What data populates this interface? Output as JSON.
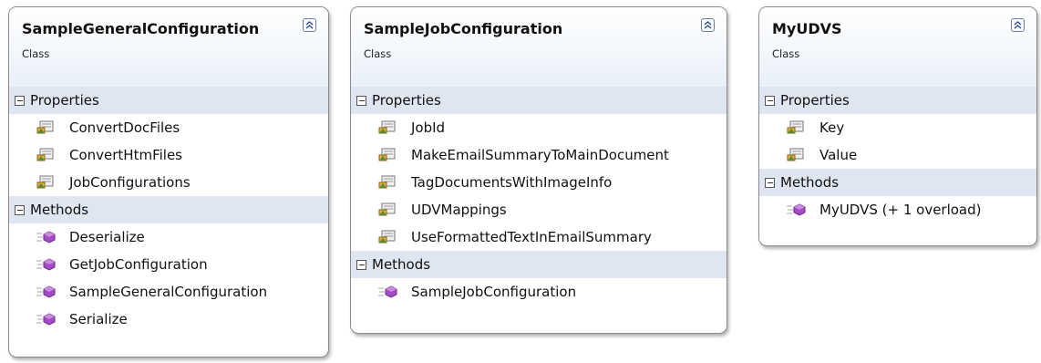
{
  "classes": [
    {
      "name": "SampleGeneralConfiguration",
      "stereotype": "Class",
      "properties_label": "Properties",
      "properties": [
        "ConvertDocFiles",
        "ConvertHtmFiles",
        "JobConfigurations"
      ],
      "methods_label": "Methods",
      "methods": [
        "Deserialize",
        "GetJobConfiguration",
        "SampleGeneralConfiguration",
        "Serialize"
      ]
    },
    {
      "name": "SampleJobConfiguration",
      "stereotype": "Class",
      "properties_label": "Properties",
      "properties": [
        "JobId",
        "MakeEmailSummaryToMainDocument",
        "TagDocumentsWithImageInfo",
        "UDVMappings",
        "UseFormattedTextInEmailSummary"
      ],
      "methods_label": "Methods",
      "methods": [
        "SampleJobConfiguration"
      ]
    },
    {
      "name": "MyUDVS",
      "stereotype": "Class",
      "properties_label": "Properties",
      "properties": [
        "Key",
        "Value"
      ],
      "methods_label": "Methods",
      "methods": [
        "MyUDVS (+ 1 overload)"
      ]
    }
  ],
  "icons": {
    "property": "property-icon",
    "method": "method-icon",
    "collapse": "collapse-chevrons-icon",
    "section_toggle": "minus-expander-icon"
  },
  "colors": {
    "header_gradient_bottom": "#eaf0f8",
    "section_band": "#dfe6f2",
    "method_icon": "#a24bc4"
  }
}
